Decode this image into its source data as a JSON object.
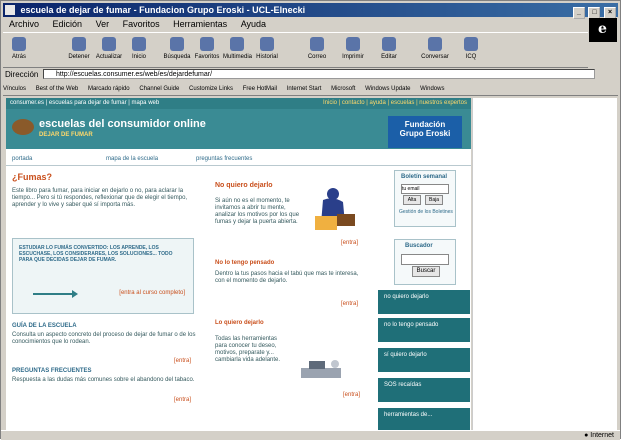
{
  "window": {
    "title": "escuela de dejar de fumar - Fundacion Grupo Eroski - UCL-Elnecki"
  },
  "menu": [
    "Archivo",
    "Edición",
    "Ver",
    "Favoritos",
    "Herramientas",
    "Ayuda"
  ],
  "toolbar": [
    {
      "label": "Atrás"
    },
    {
      "label": "Detener"
    },
    {
      "label": "Actualizar"
    },
    {
      "label": "Inicio"
    },
    {
      "label": "Búsqueda"
    },
    {
      "label": "Favoritos"
    },
    {
      "label": "Multimedia"
    },
    {
      "label": "Historial"
    },
    {
      "label": "Correo"
    },
    {
      "label": "Imprimir"
    },
    {
      "label": "Editar"
    },
    {
      "label": "Conversar"
    },
    {
      "label": "ICQ"
    }
  ],
  "address": {
    "label": "Dirección",
    "value": "http://escuelas.consumer.es/web/es/dejardefumar/"
  },
  "links": {
    "label": "Vínculos",
    "items": [
      "Best of the Web",
      "Marcado rápido",
      "Channel Guide",
      "Customize Links",
      "Free HotMail",
      "Internet Start",
      "Microsoft",
      "Windows Update",
      "Windows"
    ]
  },
  "site": {
    "topstrip_left": "consumer.es | escuelas para dejar de fumar | mapa web",
    "topstrip_right": "Inicio | contacto | ayuda | escuelas | nuestros expertos",
    "brand": "escuelas del consumidor online",
    "brand_sub": "DEJAR DE FUMAR",
    "fundacion_line1": "Fundación",
    "fundacion_line2": "Grupo Eroski",
    "nav": [
      "portada",
      "mapa de la escuela",
      "preguntas frecuentes"
    ],
    "fumas_title": "¿Fumas?",
    "fumas_text": "Este libro para fumar, para iniciar en dejarlo o no, para aclarar la tiempo... Pero si tú respondes, reflexionar que de elegir el tiempo, aprender y lo vive y saber qué sí importa más.",
    "box_text": "ESTUDIAR LO FUMÁS CONVERTIDO: LOS APRENDE, LOS ESCUCHASE, LOS CONSIDERARES, LOS SOLUCIONES... TODO PARA QUE DECIDAS DEJAR DE FUMAR.",
    "box_link": "[entra al curso completo]",
    "guide_title": "GUÍA DE LA ESCUELA",
    "guide_text": "Consulta un aspecto concreto del proceso de dejar de fumar o de los conocimientos que lo rodean.",
    "guide_link": "[entra]",
    "faq_title": "PREGUNTAS FRECUENTES",
    "faq_text": "Respuesta a las dudas más comunes sobre el abandono del tabaco.",
    "faq_link": "[entra]",
    "c2_title": "No quiero dejarlo",
    "c2_text": "Si aún no es el momento, te invitamos a abrir tu mente, analizar los motivos por los que fumas y dejar la puerta abierta.",
    "c2_link": "[entra]",
    "c2b_title": "No lo tengo pensado",
    "c2b_text": "Dentro la tus pasos hacia el tabú que mas te interesa, con el momento de dejarlo.",
    "c2b_link": "[entra]",
    "c2c_title": "Lo quiero dejarlo",
    "c2c_text": "Todas las herramientas para conocer tu deseo, motivos, preparate y... cambiarla vida adelante.",
    "c2c_link": "[entra]",
    "bulletin_title": "Boletín semanal",
    "bulletin_input": "tu email",
    "bulletin_alta": "Alta",
    "bulletin_baja": "Baja",
    "bulletin_note": "Gestión de los Boletines",
    "search_title": "Buscador",
    "search_button": "Buscar",
    "side_buttons": [
      "no quiero dejarlo",
      "no lo tengo pensado",
      "sí quiero dejarlo",
      "SOS recaídas",
      "herramientas de..."
    ]
  },
  "status": {
    "zone": "Internet"
  }
}
